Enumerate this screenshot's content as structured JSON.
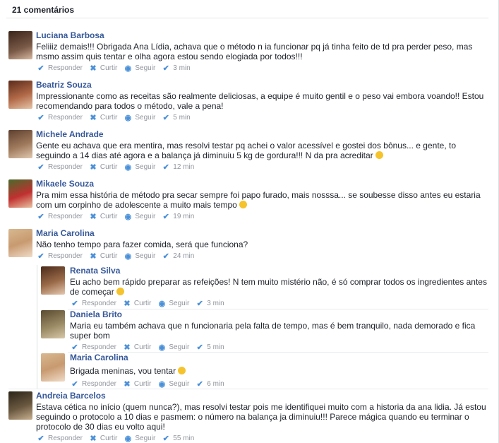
{
  "header": {
    "count_label": "21 comentários"
  },
  "actions": {
    "reply": "Responder",
    "like": "Curtir",
    "follow": "Seguir"
  },
  "comments": [
    {
      "name": "Luciana Barbosa",
      "text": "Feliiiz demais!!! Obrigada Ana Lídia, achava que o método n ia funcionar pq já tinha feito de td pra perder peso, mas msmo assim quis tentar e olha agora estou sendo elogiada por todos!!!",
      "time": "3 min",
      "avatar": "#5b3a2a"
    },
    {
      "name": "Beatriz Souza",
      "text": "Impressionante como as receitas são realmente deliciosas, a equipe é muito gentil e o peso vai embora voando!! Estou recomendando para todos o método, vale a pena!",
      "time": "5 min",
      "avatar": "#a0523a"
    },
    {
      "name": "Michele Andrade",
      "text": "Gente eu achava que era mentira, mas resolvi testar pq achei o valor acessível e gostei dos bônus... e gente, to seguindo a 14 dias até agora e a balança já diminuiu 5 kg de gordura!!! N da pra acreditar",
      "time": "12 min",
      "avatar": "#7a5a44"
    },
    {
      "name": "Mikaele Souza",
      "text": "Pra mim essa história de método pra secar sempre foi papo furado, mais nosssa... se soubesse disso antes eu estaria com um corpinho de adolescente a muito mais tempo",
      "time": "19 min",
      "avatar": "#6e8a3a"
    },
    {
      "name": "Maria Carolina",
      "text": "Não tenho tempo para fazer comida, será que funciona?",
      "time": "24 min",
      "avatar": "#c89a70"
    },
    {
      "name": "Andreia Barcelos",
      "text": "Estava cética no início (quem nunca?), mas resolvi testar pois me identifiquei muito com a historia da ana lidia. Já estou seguindo o protocolo a 10 dias e pasmem: o número na balança ja diminuiu!!! Parece mágica quando eu terminar o protocolo de 30 dias eu volto aqui!",
      "time": "55 min",
      "avatar": "#6a5840"
    }
  ],
  "replies": [
    {
      "name": "Renata Silva",
      "text": "Eu acho bem rápido preparar as refeições! N tem muito mistério não, é só comprar todos os ingredientes antes de começar",
      "time": "3 min",
      "avatar": "#7a5036"
    },
    {
      "name": "Daniela Brito",
      "text": "Maria eu também achava que n funcionaria pela falta de tempo, mas é bem tranquilo, nada demorado e fica super bom",
      "time": "5 min",
      "avatar": "#8a7a5a"
    },
    {
      "name": "Maria Carolina",
      "text": "Brigada meninas, vou tentar",
      "time": "6 min",
      "avatar": "#c89a70"
    }
  ]
}
